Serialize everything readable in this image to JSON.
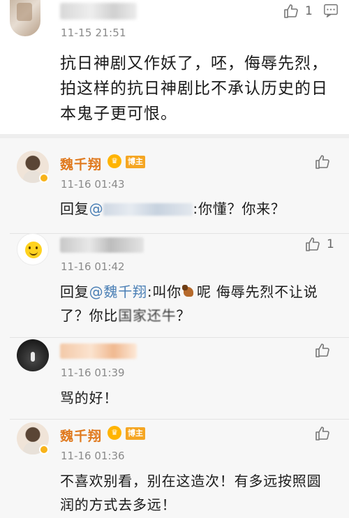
{
  "main_comment": {
    "time": "11-15 21:51",
    "text": "抗日神剧又作妖了，呸，侮辱先烈，拍这样的抗日神剧比不承认历史的日本鬼子更可恨。",
    "like_count": "1"
  },
  "replies": [
    {
      "name": "魏千翔",
      "badge": "博主",
      "time": "11-16 01:43",
      "prefix": "回复",
      "mention": "@",
      "body": ":你懂？你来？",
      "like_count": ""
    },
    {
      "name": "",
      "badge": "",
      "time": "11-16 01:42",
      "prefix": "回复",
      "mention": "@魏千翔",
      "body_a": ":叫你",
      "body_b": "呢 侮辱先烈不让说了？你比",
      "body_c": "国家还牛",
      "body_d": "？",
      "like_count": "1"
    },
    {
      "name": "",
      "time": "11-16 01:39",
      "body": "骂的好！",
      "like_count": ""
    },
    {
      "name": "魏千翔",
      "badge": "博主",
      "time": "11-16 01:36",
      "body": "不喜欢别看，别在这造次！有多远按照圆润的方式去多远！",
      "like_count": ""
    }
  ],
  "colors": {
    "name_orange": "#e07a1f",
    "mention_blue": "#4a7fb5",
    "badge_orange": "#f5a623"
  },
  "icons": [
    "thumbs-up-icon",
    "chat-icon",
    "crown-icon",
    "verified-icon",
    "horse-emoji-icon"
  ]
}
